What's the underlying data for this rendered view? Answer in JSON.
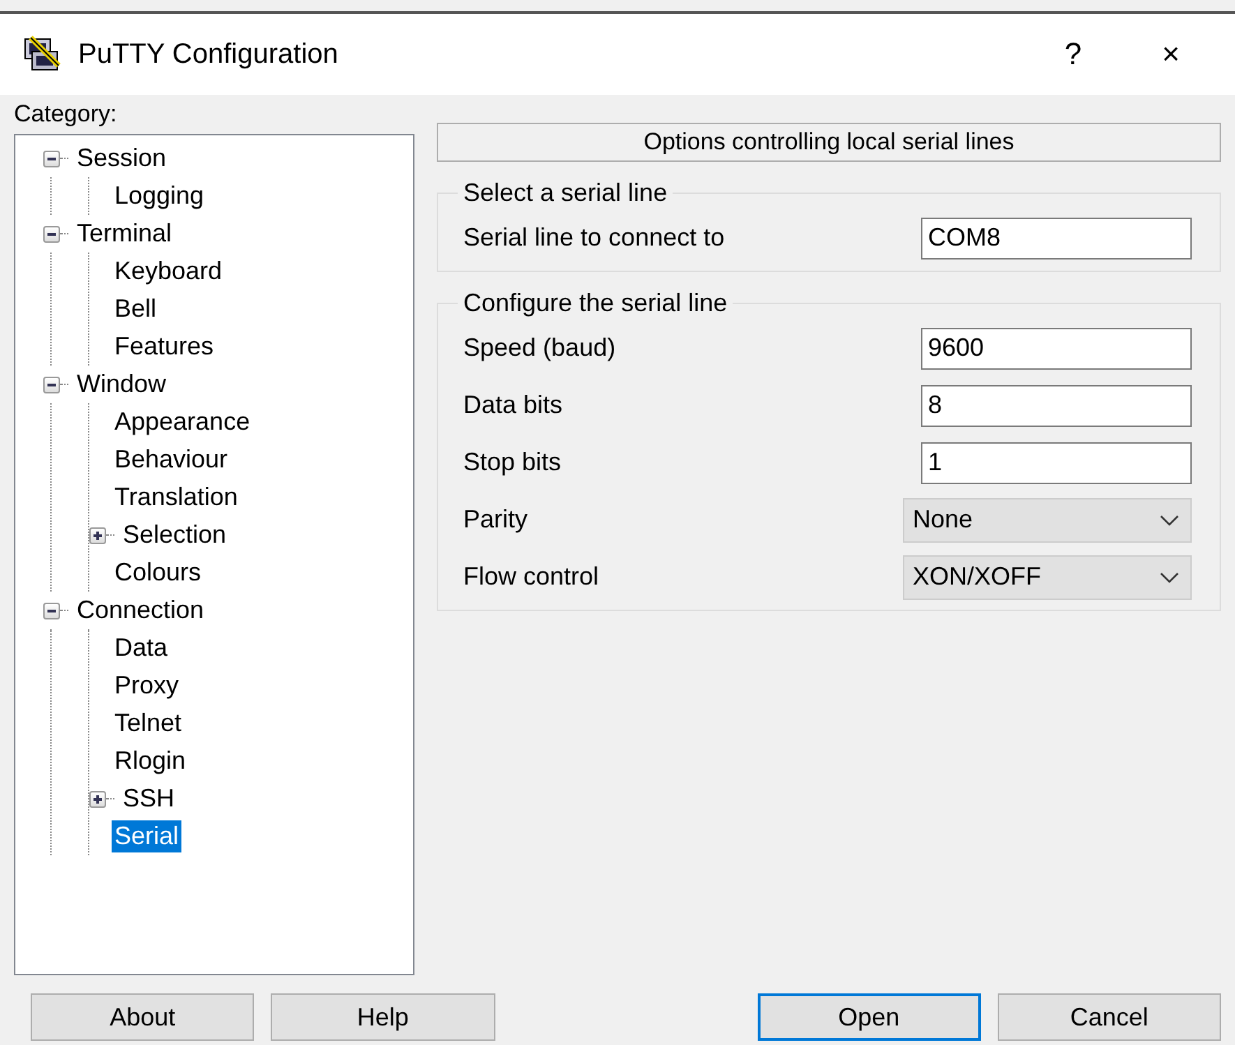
{
  "window": {
    "title": "PuTTY Configuration",
    "help": "?",
    "close": "×"
  },
  "category_label": "Category:",
  "tree": [
    {
      "label": "Session",
      "expanded": true,
      "selected": false,
      "children": [
        {
          "label": "Logging",
          "selected": false
        }
      ]
    },
    {
      "label": "Terminal",
      "expanded": true,
      "selected": false,
      "children": [
        {
          "label": "Keyboard",
          "selected": false
        },
        {
          "label": "Bell",
          "selected": false
        },
        {
          "label": "Features",
          "selected": false
        }
      ]
    },
    {
      "label": "Window",
      "expanded": true,
      "selected": false,
      "children": [
        {
          "label": "Appearance",
          "selected": false
        },
        {
          "label": "Behaviour",
          "selected": false
        },
        {
          "label": "Translation",
          "selected": false
        },
        {
          "label": "Selection",
          "expanded": false,
          "selected": false
        },
        {
          "label": "Colours",
          "selected": false
        }
      ]
    },
    {
      "label": "Connection",
      "expanded": true,
      "selected": false,
      "children": [
        {
          "label": "Data",
          "selected": false
        },
        {
          "label": "Proxy",
          "selected": false
        },
        {
          "label": "Telnet",
          "selected": false
        },
        {
          "label": "Rlogin",
          "selected": false
        },
        {
          "label": "SSH",
          "expanded": false,
          "selected": false
        },
        {
          "label": "Serial",
          "selected": true
        }
      ]
    }
  ],
  "panel_header": "Options controlling local serial lines",
  "groups": [
    {
      "title": "Select a serial line",
      "fields": [
        {
          "label": "Serial line to connect to",
          "kind": "text",
          "value": "COM8"
        }
      ]
    },
    {
      "title": "Configure the serial line",
      "fields": [
        {
          "label": "Speed (baud)",
          "kind": "text",
          "value": "9600"
        },
        {
          "label": "Data bits",
          "kind": "text",
          "value": "8"
        },
        {
          "label": "Stop bits",
          "kind": "text",
          "value": "1"
        },
        {
          "label": "Parity",
          "kind": "dropdown",
          "value": "None"
        },
        {
          "label": "Flow control",
          "kind": "dropdown",
          "value": "XON/XOFF"
        }
      ]
    }
  ],
  "buttons": [
    {
      "label": "About",
      "default": false
    },
    {
      "label": "Help",
      "default": false
    },
    {
      "label": "Open",
      "default": true
    },
    {
      "label": "Cancel",
      "default": false
    }
  ]
}
